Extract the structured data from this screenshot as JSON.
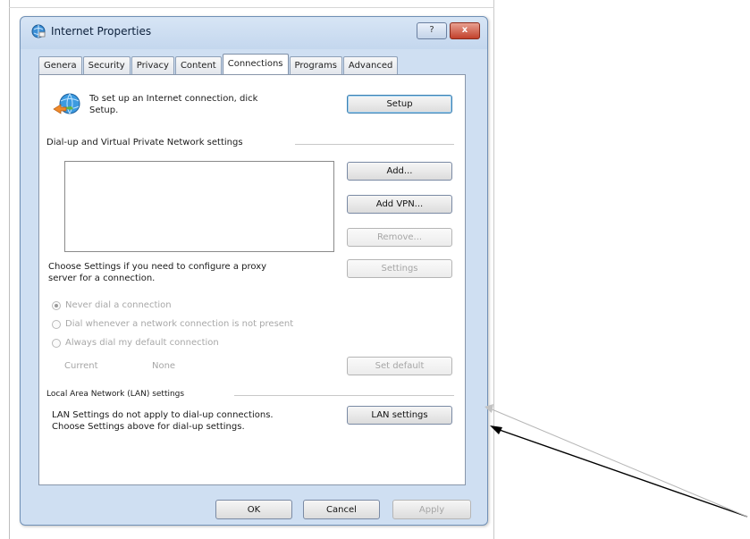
{
  "window": {
    "title": "Internet Properties",
    "help_label": "?",
    "close_label": "x"
  },
  "tabs": [
    {
      "label": "Genera"
    },
    {
      "label": "Security"
    },
    {
      "label": "Privacy"
    },
    {
      "label": "Content"
    },
    {
      "label": "Connections"
    },
    {
      "label": "Programs"
    },
    {
      "label": "Advanced"
    }
  ],
  "active_tab": "Connections",
  "setup": {
    "text_line1": "To set up an Internet connection, dick",
    "text_line2": "Setup.",
    "button": "Setup"
  },
  "dialup": {
    "group_label": "Dial-up and Virtual Private Network settings",
    "add_button": "Add...",
    "add_vpn_button": "Add VPN...",
    "remove_button": "Remove...",
    "proxy_text_line1": "Choose Settings if you need to configure a proxy",
    "proxy_text_line2": "server for a connection.",
    "settings_button": "Settings",
    "radio_options": [
      {
        "label": "Never dial a connection",
        "checked": true
      },
      {
        "label": "Dial whenever a network connection is not present",
        "checked": false
      },
      {
        "label": "Always dial my default connection",
        "checked": false
      }
    ],
    "current_label": "Current",
    "current_value": "None",
    "set_default_button": "Set default"
  },
  "lan": {
    "group_label": "Local Area Network (LAN) settings",
    "text_line1": "LAN Settings do not apply to dial-up connections.",
    "text_line2": "Choose Settings above for dial-up settings.",
    "button": "LAN settings"
  },
  "footer": {
    "ok": "OK",
    "cancel": "Cancel",
    "apply": "Apply"
  },
  "colors": {
    "accent_border": "#3c7fb1",
    "title_bg": "#c4d7ee",
    "arrow": "#000000"
  }
}
